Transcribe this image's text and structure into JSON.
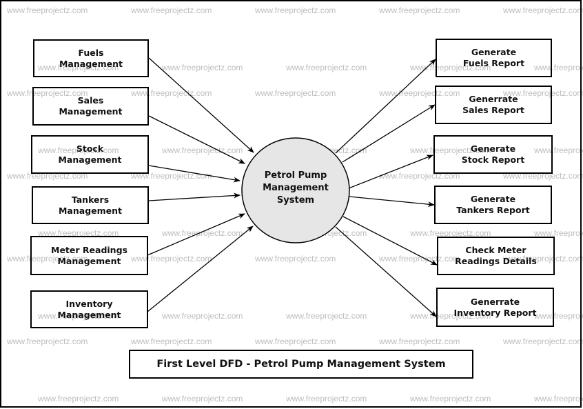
{
  "diagram": {
    "title": "First Level DFD - Petrol Pump Management System",
    "watermark": "www.freeprojectz.com",
    "central_process": {
      "label": "Petrol Pump\nManagement\nSystem",
      "fill": "#e6e6e6"
    },
    "inputs": [
      {
        "id": "fuels",
        "label": "Fuels\nManagement"
      },
      {
        "id": "sales",
        "label": "Sales\nManagement"
      },
      {
        "id": "stock",
        "label": "Stock\nManagement"
      },
      {
        "id": "tankers",
        "label": "Tankers\nManagement"
      },
      {
        "id": "meter",
        "label": "Meter Readings\nManagement"
      },
      {
        "id": "inventory",
        "label": "Inventory\nManagement"
      }
    ],
    "outputs": [
      {
        "id": "fuels-report",
        "label": "Generate\nFuels Report"
      },
      {
        "id": "sales-report",
        "label": "Generrate\nSales Report"
      },
      {
        "id": "stock-report",
        "label": "Generate\nStock Report"
      },
      {
        "id": "tankers-report",
        "label": "Generate\nTankers Report"
      },
      {
        "id": "meter-details",
        "label": "Check Meter\nReadings Details"
      },
      {
        "id": "inventory-report",
        "label": "Generrate\nInventory Report"
      }
    ],
    "flows": [
      {
        "from": "fuels",
        "to": "central_process"
      },
      {
        "from": "sales",
        "to": "central_process"
      },
      {
        "from": "stock",
        "to": "central_process"
      },
      {
        "from": "tankers",
        "to": "central_process"
      },
      {
        "from": "meter",
        "to": "central_process"
      },
      {
        "from": "inventory",
        "to": "central_process"
      },
      {
        "from": "central_process",
        "to": "fuels-report"
      },
      {
        "from": "central_process",
        "to": "sales-report"
      },
      {
        "from": "central_process",
        "to": "stock-report"
      },
      {
        "from": "central_process",
        "to": "tankers-report"
      },
      {
        "from": "central_process",
        "to": "meter-details"
      },
      {
        "from": "central_process",
        "to": "inventory-report"
      }
    ]
  }
}
